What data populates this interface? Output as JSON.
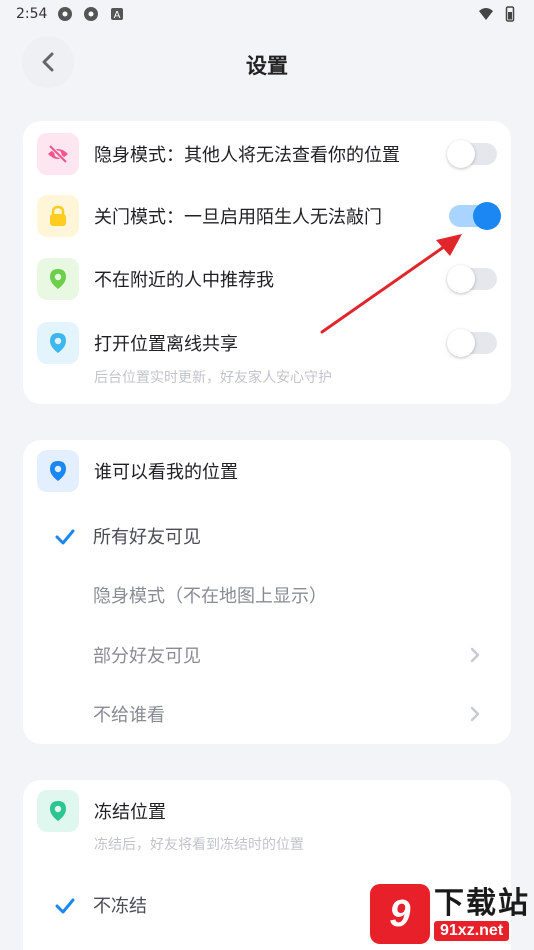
{
  "status_bar": {
    "time": "2:54",
    "icons": [
      "app-notification-icon",
      "app-notification-icon",
      "a-badge-icon",
      "wifi-icon",
      "battery-icon"
    ]
  },
  "header": {
    "title": "设置",
    "back_icon": "chevron-left-icon"
  },
  "privacy_card": {
    "items": [
      {
        "label": "隐身模式：其他人将无法查看你的位置",
        "icon": "eye-off-icon",
        "icon_bg": "#fde6ef",
        "icon_color": "#f2558c",
        "enabled": false
      },
      {
        "label": "关门模式：一旦启用陌生人无法敲门",
        "icon": "lock-icon",
        "icon_bg": "#fff6d9",
        "icon_color": "#ffcc1f",
        "enabled": true
      },
      {
        "label": "不在附近的人中推荐我",
        "icon": "location-pin-icon",
        "icon_bg": "#e8f8e2",
        "icon_color": "#6ed04a",
        "enabled": false
      },
      {
        "label": "打开位置离线共享",
        "icon": "location-pin-icon",
        "icon_bg": "#e3f4fd",
        "icon_color": "#3cb8ee",
        "enabled": false
      }
    ],
    "offline_desc": "后台位置实时更新，好友家人安心守护"
  },
  "visibility_card": {
    "title": "谁可以看我的位置",
    "icon": "location-pin-icon",
    "icon_bg": "#e3efff",
    "icon_color": "#1b87f3",
    "options": [
      {
        "label": "所有好友可见",
        "selected": true,
        "has_chevron": false
      },
      {
        "label": "隐身模式（不在地图上显示）",
        "selected": false,
        "has_chevron": false
      },
      {
        "label": "部分好友可见",
        "selected": false,
        "has_chevron": true
      },
      {
        "label": "不给谁看",
        "selected": false,
        "has_chevron": true
      }
    ]
  },
  "freeze_card": {
    "title": "冻结位置",
    "icon": "location-pin-icon",
    "icon_bg": "#dff7ef",
    "icon_color": "#2cc490",
    "desc": "冻结后，好友将看到冻结时的位置",
    "options": [
      {
        "label": "不冻结",
        "selected": true
      }
    ]
  },
  "watermark": {
    "logo": "9",
    "title": "下载站",
    "url": "91xz.net"
  },
  "colors": {
    "accent": "#1b87f3",
    "arrow_annotation": "#e0262b"
  }
}
